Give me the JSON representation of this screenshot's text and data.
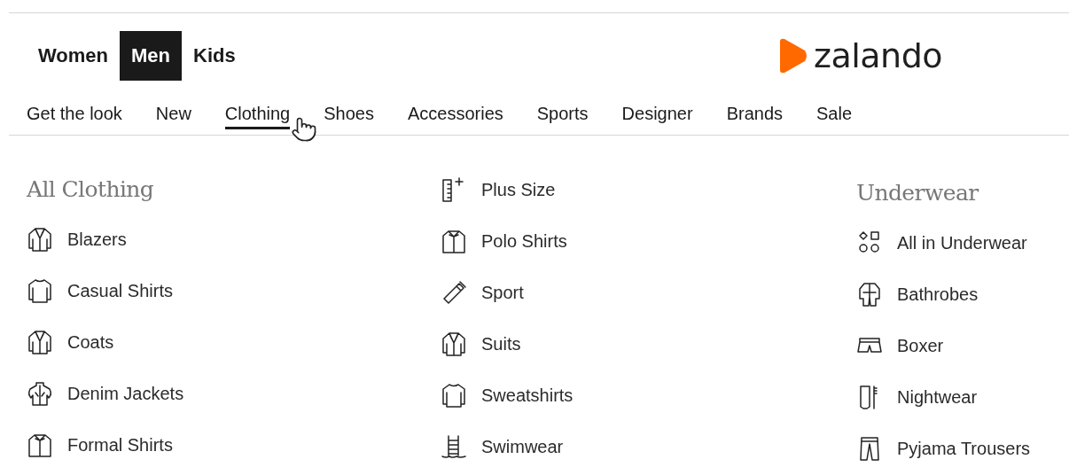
{
  "gender_tabs": [
    {
      "label": "Women",
      "selected": false
    },
    {
      "label": "Men",
      "selected": true
    },
    {
      "label": "Kids",
      "selected": false
    }
  ],
  "logo": {
    "text": "zalando"
  },
  "categories": [
    {
      "label": "Get the look",
      "selected": false
    },
    {
      "label": "New",
      "selected": false
    },
    {
      "label": "Clothing",
      "selected": true
    },
    {
      "label": "Shoes",
      "selected": false
    },
    {
      "label": "Accessories",
      "selected": false
    },
    {
      "label": "Sports",
      "selected": false
    },
    {
      "label": "Designer",
      "selected": false
    },
    {
      "label": "Brands",
      "selected": false
    },
    {
      "label": "Sale",
      "selected": false
    }
  ],
  "menu_columns": [
    {
      "heading": "All Clothing",
      "items": [
        {
          "label": "Blazers"
        },
        {
          "label": "Casual Shirts"
        },
        {
          "label": "Coats"
        },
        {
          "label": "Denim Jackets"
        },
        {
          "label": "Formal Shirts"
        }
      ]
    },
    {
      "items": [
        {
          "label": "Plus Size"
        },
        {
          "label": "Polo Shirts"
        },
        {
          "label": "Sport"
        },
        {
          "label": "Suits"
        },
        {
          "label": "Sweatshirts"
        },
        {
          "label": "Swimwear"
        }
      ]
    },
    {
      "heading": "Underwear",
      "items": [
        {
          "label": "All in Underwear"
        },
        {
          "label": "Bathrobes"
        },
        {
          "label": "Boxer"
        },
        {
          "label": "Nightwear"
        },
        {
          "label": "Pyjama Trousers"
        }
      ]
    }
  ]
}
